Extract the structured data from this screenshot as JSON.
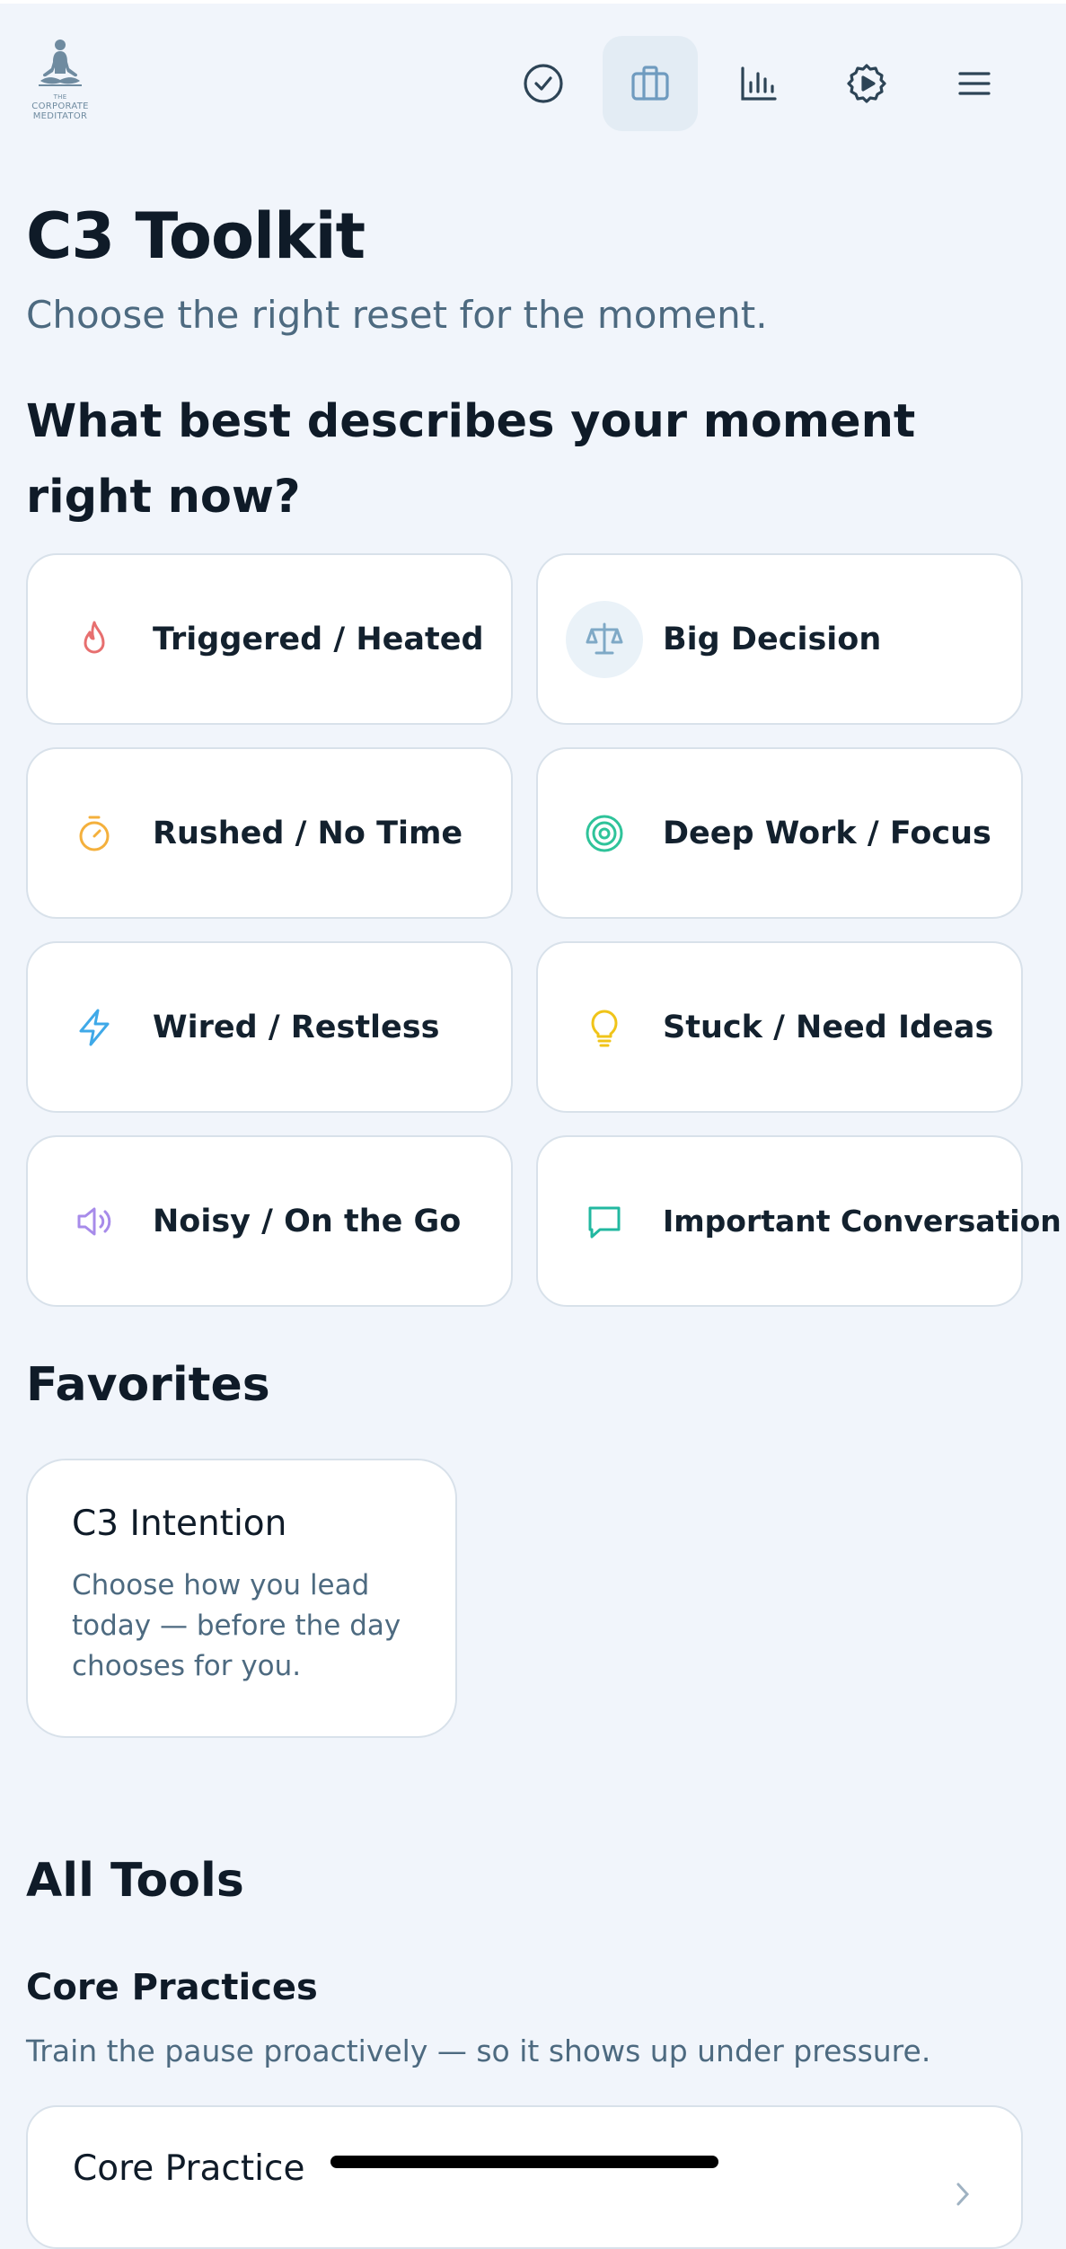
{
  "header": {
    "logo": {
      "small": "THE",
      "line1": "CORPORATE",
      "line2": "MEDITATOR"
    },
    "nav": [
      {
        "icon": "check-circle-icon",
        "active": false
      },
      {
        "icon": "briefcase-icon",
        "active": true
      },
      {
        "icon": "bar-chart-icon",
        "active": false
      },
      {
        "icon": "gear-icon",
        "active": false
      },
      {
        "icon": "menu-icon",
        "active": false
      }
    ]
  },
  "page": {
    "title": "C3 Toolkit",
    "subtitle": "Choose the right reset for the moment.",
    "question": "What best describes your moment right now?"
  },
  "moods": [
    {
      "label": "Triggered / Heated",
      "icon": "flame-icon",
      "color": "#e76f6f"
    },
    {
      "label": "Big Decision",
      "icon": "scale-icon",
      "color": "#7fa9c6"
    },
    {
      "label": "Rushed / No Time",
      "icon": "timer-icon",
      "color": "#f4b03c"
    },
    {
      "label": "Deep Work / Focus",
      "icon": "target-icon",
      "color": "#2fc39a"
    },
    {
      "label": "Wired / Restless",
      "icon": "lightning-icon",
      "color": "#3fa9e8"
    },
    {
      "label": "Stuck / Need Ideas",
      "icon": "lightbulb-icon",
      "color": "#f0c419"
    },
    {
      "label": "Noisy / On the Go",
      "icon": "speaker-icon",
      "color": "#a78bea"
    },
    {
      "label": "Important Conversation",
      "icon": "chat-icon",
      "color": "#22b8a0"
    }
  ],
  "favorites": {
    "heading": "Favorites",
    "items": [
      {
        "title": "C3 Intention",
        "description": "Choose how you lead today — before the day chooses for you."
      }
    ]
  },
  "all_tools": {
    "heading": "All Tools",
    "section_title": "Core Practices",
    "section_desc": "Train the pause proactively — so it shows up under pressure.",
    "items": [
      {
        "title": "Core Practice"
      }
    ]
  },
  "colors": {
    "background": "#f1f5fb",
    "accent": "#6f8ba0",
    "active_nav": "#e3ecf4"
  }
}
